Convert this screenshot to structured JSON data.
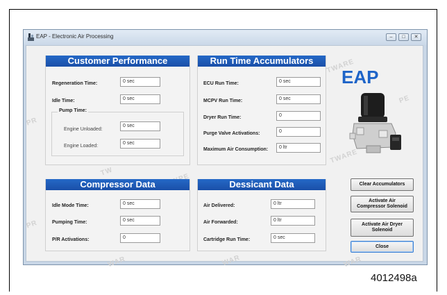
{
  "window": {
    "title": "EAP - Electronic Air Processing",
    "controls": [
      "minimize-icon",
      "maximize-icon",
      "close-icon"
    ]
  },
  "customer_performance": {
    "title": "Customer Performance",
    "regeneration_label": "Regeneration Time:",
    "regeneration_value": "0 sec",
    "idle_label": "Idle Time:",
    "idle_value": "0 sec",
    "pump_label": "Pump Time:",
    "unloaded_label": "Engine Unloaded:",
    "unloaded_value": "0 sec",
    "loaded_label": "Engine Loaded:",
    "loaded_value": "0 sec"
  },
  "run_time": {
    "title": "Run Time Accumulators",
    "ecu_label": "ECU Run Time:",
    "ecu_value": "0 sec",
    "mcpv_label": "MCPV Run Time:",
    "mcpv_value": "0 sec",
    "dryer_label": "Dryer Run Time:",
    "dryer_value": "0",
    "purge_label": "Purge Valve Activations:",
    "purge_value": "0",
    "max_air_label": "Maximum Air Consumption:",
    "max_air_value": "0 ltr"
  },
  "compressor": {
    "title": "Compressor Data",
    "idle_mode_label": "Idle Mode Time:",
    "idle_mode_value": "0 sec",
    "pumping_label": "Pumping Time:",
    "pumping_value": "0 sec",
    "pr_label": "P/R Activations:",
    "pr_value": "0"
  },
  "dessicant": {
    "title": "Dessicant Data",
    "delivered_label": "Air Delivered:",
    "delivered_value": "0 ltr",
    "forwarded_label": "Air Forwarded:",
    "forwarded_value": "0 ltr",
    "cartridge_label": "Cartridge Run Time:",
    "cartridge_value": "0 sec"
  },
  "brand": {
    "logo_text": "EAP",
    "accent": "#1e64c8",
    "header_color": "#1f5bb8"
  },
  "buttons": {
    "clear": "Clear Accumulators",
    "compressor_line1": "Activate Air",
    "compressor_line2": "Compressor Solenoid",
    "dryer_line1": "Activate Air Dryer",
    "dryer_line2": "Solenoid",
    "close": "Close"
  },
  "caption": "4012498a"
}
